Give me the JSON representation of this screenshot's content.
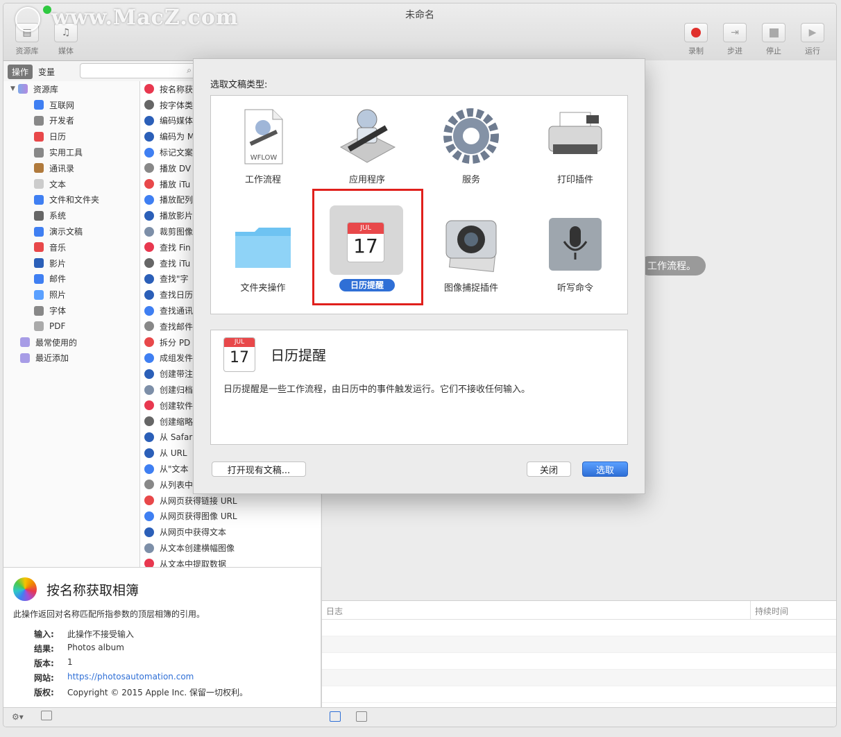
{
  "window": {
    "title": "未命名"
  },
  "watermark": "www.MacZ.com",
  "toolbar": {
    "left": [
      {
        "label": "资源库",
        "icon": "library-icon"
      },
      {
        "label": "媒体",
        "icon": "media-icon"
      }
    ],
    "right": [
      {
        "label": "录制",
        "icon": "record-icon",
        "color": "#e0302c"
      },
      {
        "label": "步进",
        "icon": "step-icon"
      },
      {
        "label": "停止",
        "icon": "stop-icon"
      },
      {
        "label": "运行",
        "icon": "run-icon"
      }
    ]
  },
  "segment": {
    "active": "操作",
    "other": "变量"
  },
  "library": {
    "root": "资源库",
    "items": [
      "互联网",
      "开发者",
      "日历",
      "实用工具",
      "通讯录",
      "文本",
      "文件和文件夹",
      "系统",
      "演示文稿",
      "音乐",
      "影片",
      "邮件",
      "照片",
      "字体",
      "PDF"
    ],
    "groups": [
      "最常使用的",
      "最近添加"
    ]
  },
  "actions": [
    "按名称获",
    "按字体类",
    "编码媒体",
    "编码为 M",
    "标记文案",
    "播放 DV",
    "播放 iTu",
    "播放配列",
    "播放影片",
    "裁剪图像",
    "查找 Fin",
    "查找 iTu",
    "查找\"字",
    "查找日历",
    "查找通讯",
    "查找邮件",
    "拆分 PD",
    "成组发件",
    "创建带注",
    "创建归档",
    "创建软件",
    "创建缩略",
    "从 Safar",
    "从 URL",
    "从\"文本",
    "从列表中",
    "从网页获得链接 URL",
    "从网页获得图像 URL",
    "从网页中获得文本",
    "从文本创建横幅图像",
    "从文本中提取数据"
  ],
  "workflow_hint": "工作流程。",
  "log": {
    "col1": "日志",
    "col2": "持续时间"
  },
  "description": {
    "name": "按名称获取相簿",
    "summary": "此操作返回对名称匹配所指参数的顶层相簿的引用。",
    "fields": [
      {
        "k": "输入:",
        "v": "此操作不接受输入"
      },
      {
        "k": "结果:",
        "v": "Photos album"
      },
      {
        "k": "版本:",
        "v": "1"
      },
      {
        "k": "网站:",
        "v": "https://photosautomation.com"
      },
      {
        "k": "版权:",
        "v": "Copyright © 2015 Apple Inc. 保留一切权利。"
      }
    ]
  },
  "modal": {
    "prompt": "选取文稿类型:",
    "types": [
      {
        "label": "工作流程",
        "icon": "workflow-doc-icon",
        "badge": "WFLOW"
      },
      {
        "label": "应用程序",
        "icon": "automator-robot-icon"
      },
      {
        "label": "服务",
        "icon": "gear-icon"
      },
      {
        "label": "打印插件",
        "icon": "printer-icon"
      },
      {
        "label": "文件夹操作",
        "icon": "folder-icon"
      },
      {
        "label": "日历提醒",
        "icon": "calendar-icon",
        "selected": true
      },
      {
        "label": "图像捕捉插件",
        "icon": "camera-icon"
      },
      {
        "label": "听写命令",
        "icon": "microphone-icon"
      }
    ],
    "calendar": {
      "month": "JUL",
      "day": "17"
    },
    "detail": {
      "title": "日历提醒",
      "body": "日历提醒是一些工作流程，由日历中的事件触发运行。它们不接收任何输入。"
    },
    "buttons": {
      "open": "打开现有文稿...",
      "close": "关闭",
      "choose": "选取"
    }
  }
}
